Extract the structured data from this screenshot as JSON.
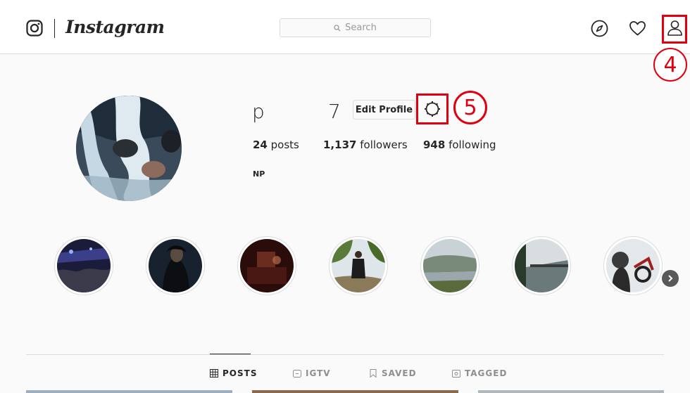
{
  "header": {
    "wordmark": "Instagram",
    "search_placeholder": "Search"
  },
  "annotations": {
    "profile_marker": "4",
    "settings_marker": "5"
  },
  "profile": {
    "username": "p",
    "username_suffix": "7",
    "edit_button": "Edit Profile",
    "full_name": "NP",
    "stats": {
      "posts_count": "24",
      "posts_label": "posts",
      "followers_count": "1,137",
      "followers_label": "followers",
      "following_count": "948",
      "following_label": "following"
    }
  },
  "tabs": [
    {
      "label": "POSTS",
      "active": true
    },
    {
      "label": "IGTV",
      "active": false
    },
    {
      "label": "SAVED",
      "active": false
    },
    {
      "label": "TAGGED",
      "active": false
    }
  ],
  "colors": {
    "annotation_red": "#e0000f",
    "text": "#262626",
    "muted": "#8e8e8e",
    "border": "#dbdbdb"
  }
}
